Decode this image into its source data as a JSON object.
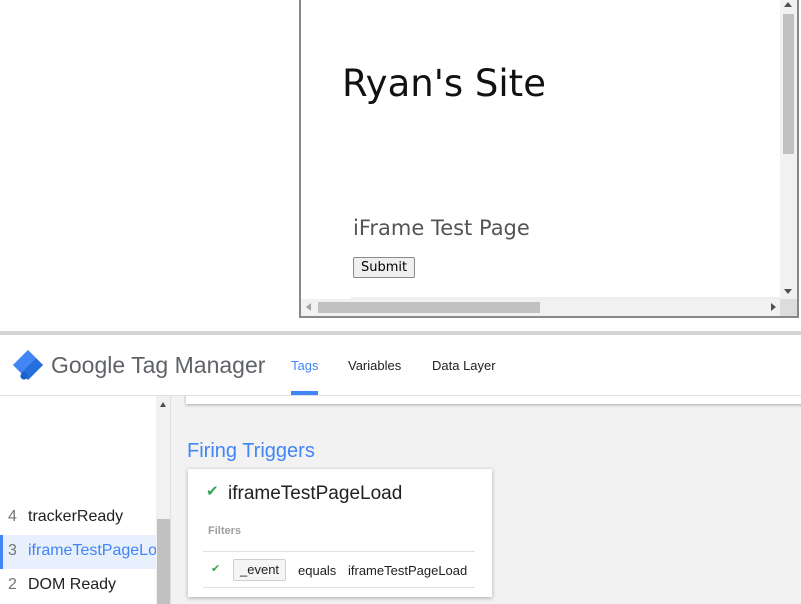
{
  "preview": {
    "site_title": "Ryan's Site",
    "page_subtitle": "iFrame Test Page",
    "submit_label": "Submit"
  },
  "header": {
    "brand": "Google Tag Manager",
    "logo_icon": "gtm-diamond-icon",
    "tabs": [
      {
        "label": "Tags",
        "active": true
      },
      {
        "label": "Variables",
        "active": false
      },
      {
        "label": "Data Layer",
        "active": false
      }
    ]
  },
  "sidebar": {
    "events": [
      {
        "number": "4",
        "name": "trackerReady",
        "selected": false
      },
      {
        "number": "3",
        "name": "iframeTestPageLoad",
        "selected": true
      },
      {
        "number": "2",
        "name": "DOM Ready",
        "selected": false
      }
    ]
  },
  "main": {
    "section_title": "Firing Triggers",
    "trigger": {
      "name": "iframeTestPageLoad",
      "filters_label": "Filters",
      "filter": {
        "variable": "_event",
        "operator": "equals",
        "value": "iframeTestPageLoad"
      }
    }
  },
  "colors": {
    "accent": "#4285f4",
    "check": "#34a853",
    "text": "#212121"
  }
}
